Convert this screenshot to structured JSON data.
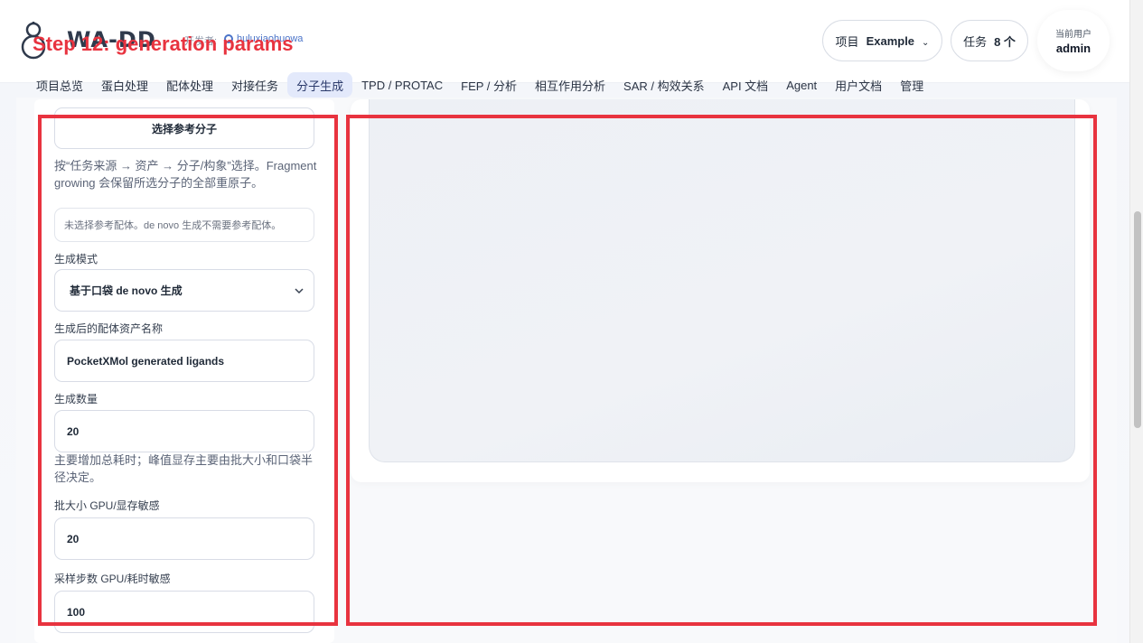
{
  "header": {
    "brand": "WA-DD",
    "developer_label": "开发者:",
    "developer_link": "huluxiaohuowa",
    "step_overlay": "Step 12: generation params",
    "project_label": "项目",
    "project_value": "Example",
    "tasks_label": "任务",
    "tasks_value": "8 个",
    "user_label": "当前用户",
    "user_name": "admin"
  },
  "nav": {
    "items": [
      {
        "label": "项目总览",
        "active": false
      },
      {
        "label": "蛋白处理",
        "active": false
      },
      {
        "label": "配体处理",
        "active": false
      },
      {
        "label": "对接任务",
        "active": false
      },
      {
        "label": "分子生成",
        "active": true
      },
      {
        "label": "TPD / PROTAC",
        "active": false
      },
      {
        "label": "FEP / 分析",
        "active": false
      },
      {
        "label": "相互作用分析",
        "active": false
      },
      {
        "label": "SAR / 构效关系",
        "active": false
      },
      {
        "label": "API 文档",
        "active": false
      },
      {
        "label": "Agent",
        "active": false
      },
      {
        "label": "用户文档",
        "active": false
      },
      {
        "label": "管理",
        "active": false
      }
    ]
  },
  "form": {
    "ref_button": "选择参考分子",
    "ref_help": "按“任务来源 → 资产 → 分子/构象”选择。Fragment growing 会保留所选分子的全部重原子。",
    "ref_status": "未选择参考配体。de novo 生成不需要参考配体。",
    "mode_label": "生成模式",
    "mode_value": "基于口袋 de novo 生成",
    "asset_name_label": "生成后的配体资产名称",
    "asset_name_value": "PocketXMol generated ligands",
    "count_label": "生成数量",
    "count_value": "20",
    "count_help": "主要增加总耗时；峰值显存主要由批大小和口袋半径决定。",
    "batch_label": "批大小 GPU/显存敏感",
    "batch_value": "20",
    "steps_label": "采样步数 GPU/耗时敏感",
    "steps_value": "100"
  },
  "colors": {
    "annotation_red": "#e8333f",
    "nav_active_bg": "#e3e9fb",
    "link_blue": "#4b74c9"
  }
}
